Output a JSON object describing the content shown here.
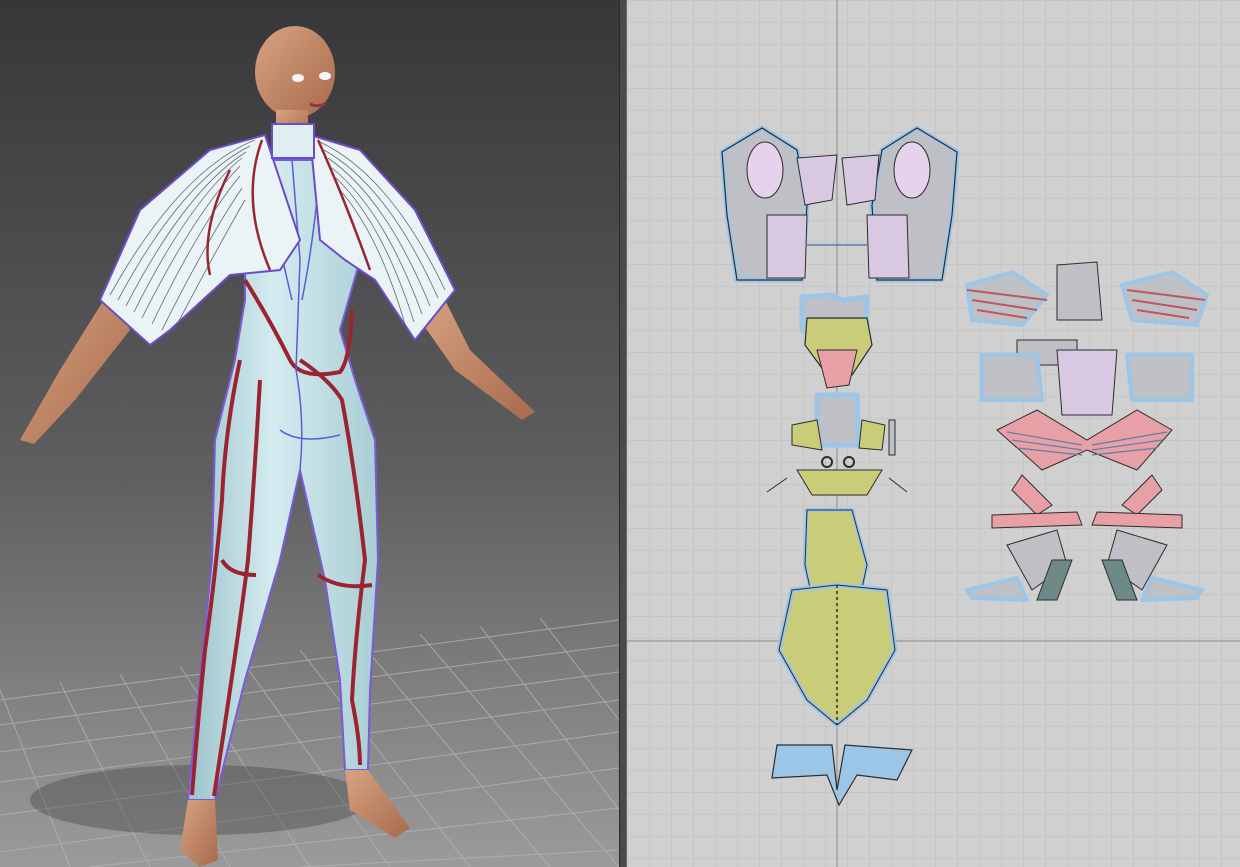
{
  "app": {
    "window_title": "",
    "views": [
      {
        "id": "avatar-3d-view",
        "kind": "3D garment simulation viewport"
      },
      {
        "id": "pattern-2d-view",
        "kind": "2D pattern layout viewport"
      }
    ]
  },
  "colors": {
    "viewport_bg_top": "#3b3b3d",
    "viewport_bg_bottom": "#8c8c8c",
    "floor_grid": "#a6a6a6",
    "garment_base": "#bfe0e6",
    "seam_red": "#9b2431",
    "seam_blue": "#5b5bd8",
    "skin": "#c98f6d",
    "pattern_bg": "#d0d0d0",
    "pattern_grid": "#bdbdbd",
    "pattern_axis": "#8a8a8a",
    "piece_fill": "#bcbcc4",
    "piece_highlight": "#9cc6e8",
    "piece_yellow": "#c9cd7a",
    "piece_pink": "#e6a0a6",
    "piece_lilac": "#d8c8e2",
    "piece_teal": "#6e8a86"
  },
  "icons": [
    "avatar-figure",
    "floor-grid",
    "pattern-pieces"
  ]
}
